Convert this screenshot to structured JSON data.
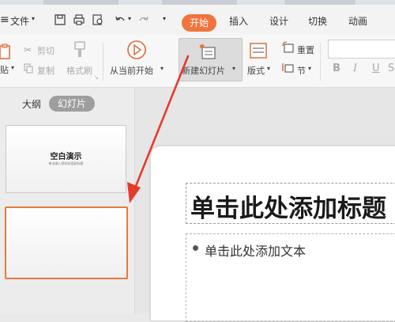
{
  "menu": {
    "file_label": "文件",
    "start_tab": "开始",
    "tabs": [
      "插入",
      "设计",
      "切换",
      "动画"
    ]
  },
  "ribbon": {
    "paste": "贴",
    "cut": "剪切",
    "copy": "复制",
    "format_painter": "格式刷",
    "from_current": "从当前开始",
    "new_slide": "新建幻灯片",
    "layout": "版式",
    "reset": "重置",
    "section": "节",
    "bold": "B",
    "italic": "I",
    "underline": "U"
  },
  "panel": {
    "outline_tab": "大纲",
    "slides_tab": "幻灯片",
    "thumb1_title": "空白演示",
    "thumb1_subtitle": "单击输入您的封面副标题"
  },
  "slide": {
    "title_placeholder": "单击此处添加标题",
    "body_placeholder": "单击此处添加文本"
  },
  "colors": {
    "accent": "#f0743c",
    "arrow": "#e63a2e"
  }
}
